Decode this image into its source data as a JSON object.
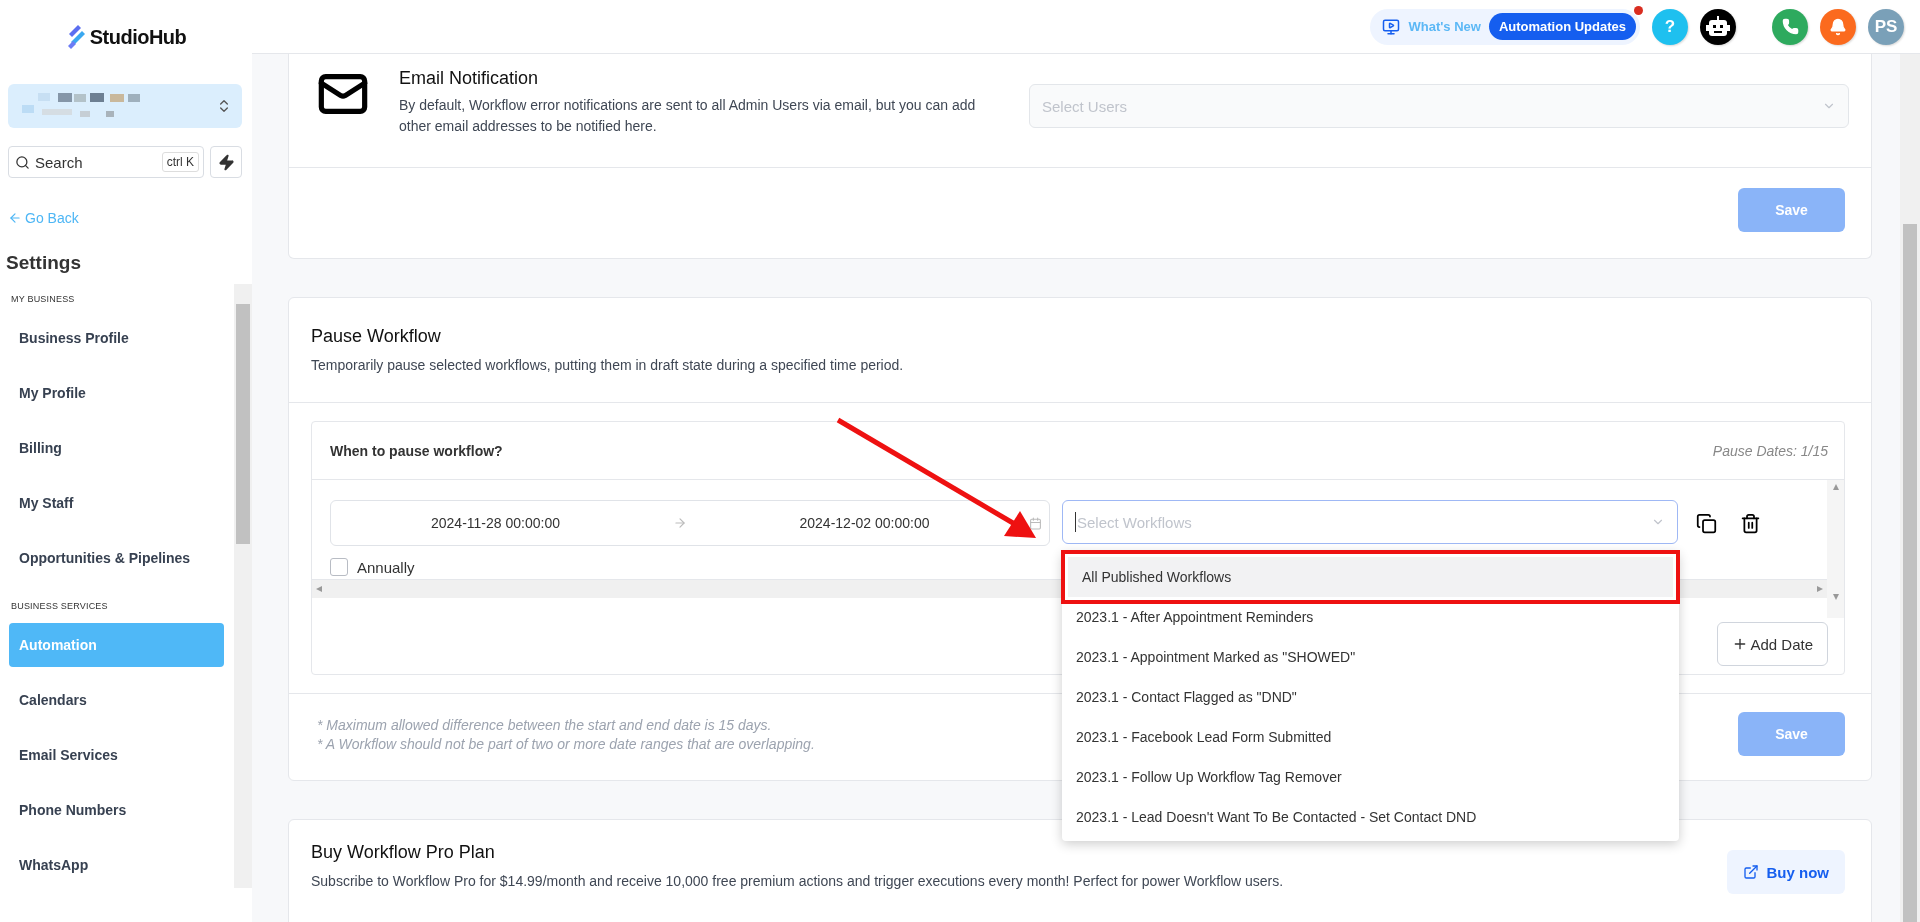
{
  "brand": {
    "name": "StudioHub"
  },
  "topbar": {
    "whats_new": "What's New",
    "updates_badge": "Automation Updates",
    "help": "?",
    "avatar": "PS"
  },
  "sidebar": {
    "search": {
      "placeholder": "Search",
      "shortcut": "ctrl K"
    },
    "back_link": "Go Back",
    "heading": "Settings",
    "groups": [
      {
        "label": "MY BUSINESS",
        "items": [
          {
            "label": "Business Profile",
            "selected": false
          },
          {
            "label": "My Profile",
            "selected": false
          },
          {
            "label": "Billing",
            "selected": false
          },
          {
            "label": "My Staff",
            "selected": false
          },
          {
            "label": "Opportunities & Pipelines",
            "selected": false
          }
        ]
      },
      {
        "label": "BUSINESS SERVICES",
        "items": [
          {
            "label": "Automation",
            "selected": true
          },
          {
            "label": "Calendars",
            "selected": false
          },
          {
            "label": "Email Services",
            "selected": false
          },
          {
            "label": "Phone Numbers",
            "selected": false
          },
          {
            "label": "WhatsApp",
            "selected": false
          }
        ]
      }
    ]
  },
  "email_notification": {
    "title": "Email Notification",
    "description": "By default, Workflow error notifications are sent to all Admin Users via email, but you can add other email addresses to be notified here.",
    "select": {
      "placeholder": "Select Users"
    },
    "save": {
      "label": "Save",
      "disabled": true
    }
  },
  "pause_workflow": {
    "title": "Pause Workflow",
    "description": "Temporarily pause selected workflows, putting them in draft state during a specified time period.",
    "panel": {
      "title": "When to pause workflow?",
      "count": "Pause Dates: 1/15",
      "range": {
        "start": "2024-11-28 00:00:00",
        "end": "2024-12-02 00:00:00"
      },
      "workflow_select": {
        "placeholder": "Select Workflows"
      },
      "annually": {
        "label": "Annually",
        "checked": false
      },
      "add_date": "Add Date"
    },
    "notes": [
      "* Maximum allowed difference between the start and end date is 15 days.",
      "* A Workflow should not be part of two or more date ranges that are overlapping."
    ],
    "save": {
      "label": "Save",
      "disabled": true
    },
    "dropdown": [
      {
        "label": "All Published Workflows",
        "selected": true
      },
      {
        "label": "2023.1 - After Appointment Reminders",
        "selected": false
      },
      {
        "label": "2023.1 - Appointment Marked as \"SHOWED\"",
        "selected": false
      },
      {
        "label": "2023.1 - Contact Flagged as \"DND\"",
        "selected": false
      },
      {
        "label": "2023.1 - Facebook Lead Form Submitted",
        "selected": false
      },
      {
        "label": "2023.1 - Follow Up Workflow Tag Remover",
        "selected": false
      },
      {
        "label": "2023.1 - Lead Doesn't Want To Be Contacted - Set Contact DND",
        "selected": false
      }
    ]
  },
  "buy_plan": {
    "title": "Buy Workflow Pro Plan",
    "description": "Subscribe to Workflow Pro for $14.99/month and receive 10,000 free premium actions and trigger executions every month! Perfect for power Workflow users.",
    "button": "Buy now"
  }
}
